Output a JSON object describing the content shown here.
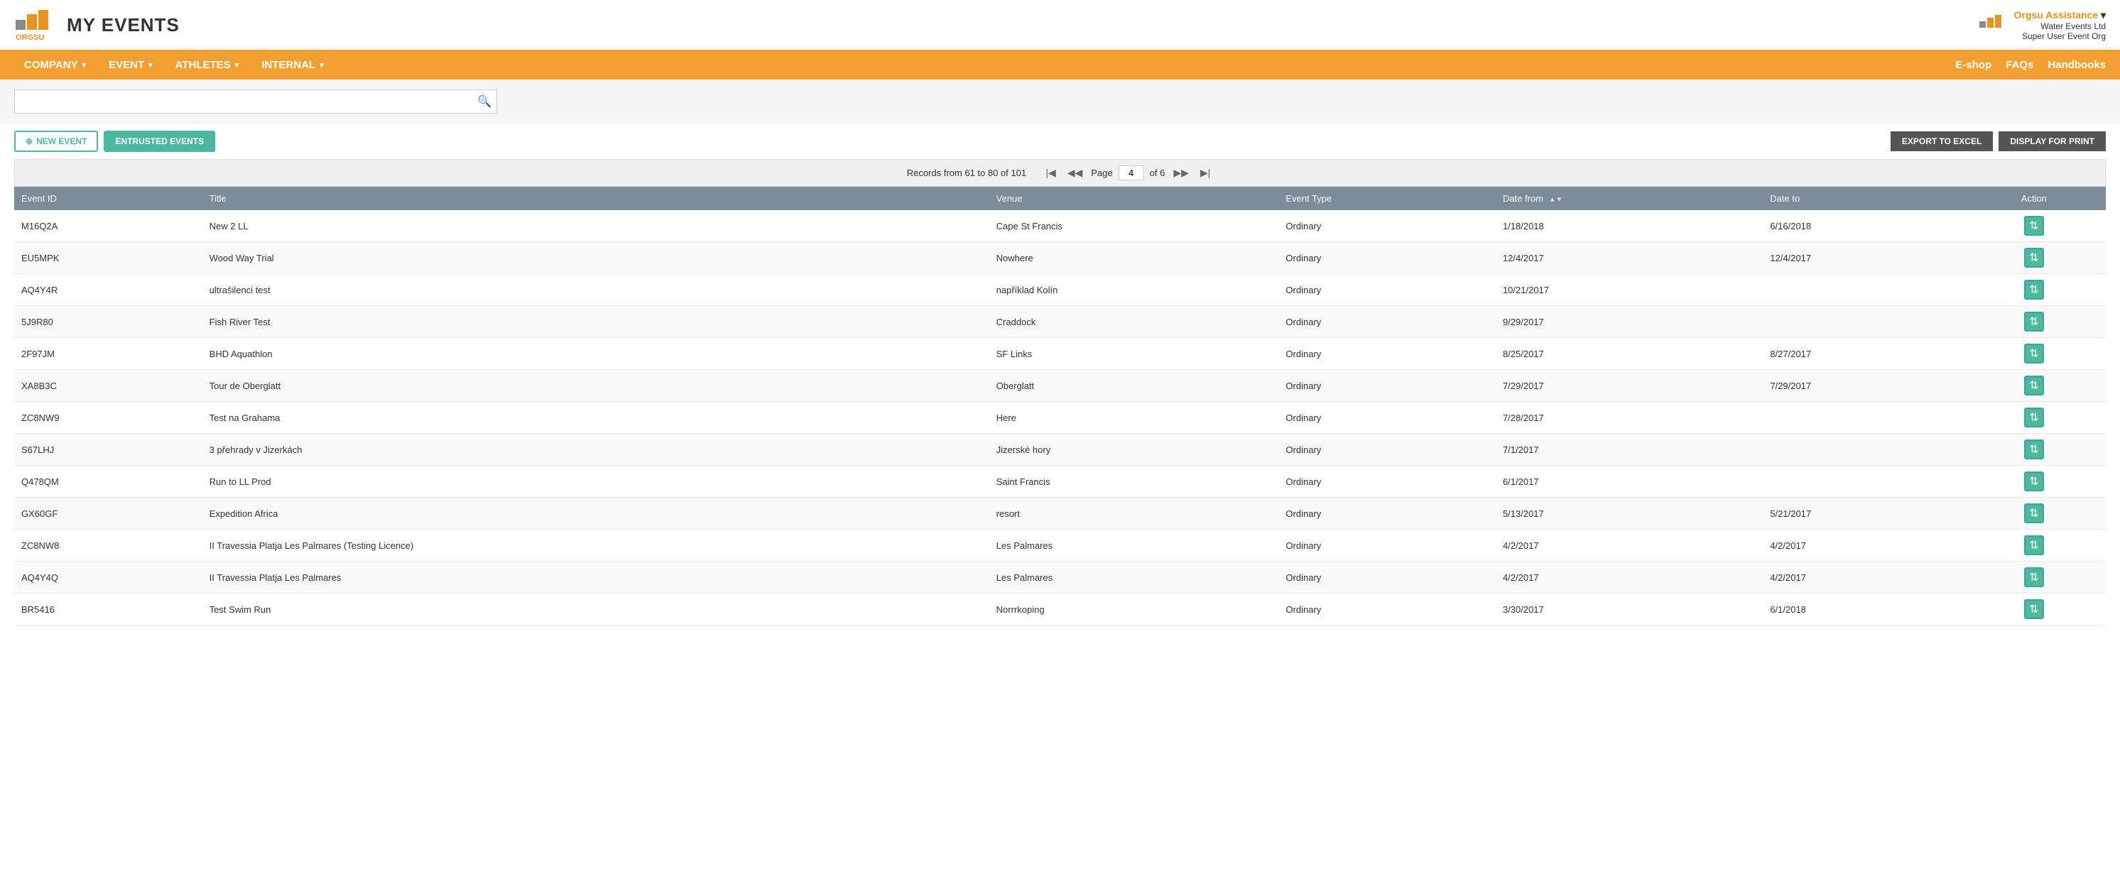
{
  "header": {
    "app_title": "MY EVENTS",
    "user_name": "Orgsu Assistance",
    "user_org1": "Water Events Ltd",
    "user_org2": "Super User Event Org"
  },
  "nav": {
    "left_items": [
      {
        "label": "COMPANY",
        "has_dropdown": true
      },
      {
        "label": "EVENT",
        "has_dropdown": true
      },
      {
        "label": "ATHLETES",
        "has_dropdown": true
      },
      {
        "label": "INTERNAL",
        "has_dropdown": true
      }
    ],
    "right_items": [
      {
        "label": "E-shop"
      },
      {
        "label": "FAQs"
      },
      {
        "label": "Handbooks"
      }
    ]
  },
  "search": {
    "placeholder": "",
    "value": ""
  },
  "toolbar": {
    "new_event_label": "NEW EVENT",
    "entrusted_label": "ENTRUSTED EVENTS",
    "export_label": "EXPORT TO EXCEL",
    "print_label": "DISPLAY FOR PRINT"
  },
  "pagination": {
    "records_text": "Records from 61 to 80 of 101",
    "current_page": "4",
    "of_pages": "of 6"
  },
  "table": {
    "columns": [
      {
        "label": "Event ID",
        "key": "event_id"
      },
      {
        "label": "Title",
        "key": "title"
      },
      {
        "label": "Venue",
        "key": "venue"
      },
      {
        "label": "Event Type",
        "key": "event_type"
      },
      {
        "label": "Date from",
        "key": "date_from",
        "sortable": true
      },
      {
        "label": "Date to",
        "key": "date_to"
      },
      {
        "label": "Action",
        "key": "action"
      }
    ],
    "rows": [
      {
        "event_id": "M16Q2A",
        "title": "New 2 LL",
        "venue": "Cape St Francis",
        "event_type": "Ordinary",
        "date_from": "1/18/2018",
        "date_to": "6/16/2018"
      },
      {
        "event_id": "EU5MPK",
        "title": "Wood Way Trial",
        "venue": "Nowhere",
        "event_type": "Ordinary",
        "date_from": "12/4/2017",
        "date_to": "12/4/2017"
      },
      {
        "event_id": "AQ4Y4R",
        "title": "ultrašilenci test",
        "venue": "například Kolín",
        "event_type": "Ordinary",
        "date_from": "10/21/2017",
        "date_to": ""
      },
      {
        "event_id": "5J9R80",
        "title": "Fish River Test",
        "venue": "Craddock",
        "event_type": "Ordinary",
        "date_from": "9/29/2017",
        "date_to": ""
      },
      {
        "event_id": "2F97JM",
        "title": "BHD Aquathlon",
        "venue": "SF Links",
        "event_type": "Ordinary",
        "date_from": "8/25/2017",
        "date_to": "8/27/2017"
      },
      {
        "event_id": "XA8B3C",
        "title": "Tour de Oberglatt",
        "venue": "Oberglatt",
        "event_type": "Ordinary",
        "date_from": "7/29/2017",
        "date_to": "7/29/2017"
      },
      {
        "event_id": "ZC8NW9",
        "title": "Test na Grahama",
        "venue": "Here",
        "event_type": "Ordinary",
        "date_from": "7/28/2017",
        "date_to": ""
      },
      {
        "event_id": "S67LHJ",
        "title": "3 přehrady v Jizerkách",
        "venue": "Jizerské hory",
        "event_type": "Ordinary",
        "date_from": "7/1/2017",
        "date_to": ""
      },
      {
        "event_id": "Q478QM",
        "title": "Run to LL Prod",
        "venue": "Saint Francis",
        "event_type": "Ordinary",
        "date_from": "6/1/2017",
        "date_to": ""
      },
      {
        "event_id": "GX60GF",
        "title": "Expedition Africa",
        "venue": "resort",
        "event_type": "Ordinary",
        "date_from": "5/13/2017",
        "date_to": "5/21/2017"
      },
      {
        "event_id": "ZC8NW8",
        "title": "II Travessia Platja Les Palmares (Testing Licence)",
        "venue": "Les Palmares",
        "event_type": "Ordinary",
        "date_from": "4/2/2017",
        "date_to": "4/2/2017"
      },
      {
        "event_id": "AQ4Y4Q",
        "title": "II Travessia Platja Les Palmares",
        "venue": "Les Palmares",
        "event_type": "Ordinary",
        "date_from": "4/2/2017",
        "date_to": "4/2/2017"
      },
      {
        "event_id": "BR5416",
        "title": "Test Swim Run",
        "venue": "Norrrkoping",
        "event_type": "Ordinary",
        "date_from": "3/30/2017",
        "date_to": "6/1/2018"
      }
    ]
  }
}
